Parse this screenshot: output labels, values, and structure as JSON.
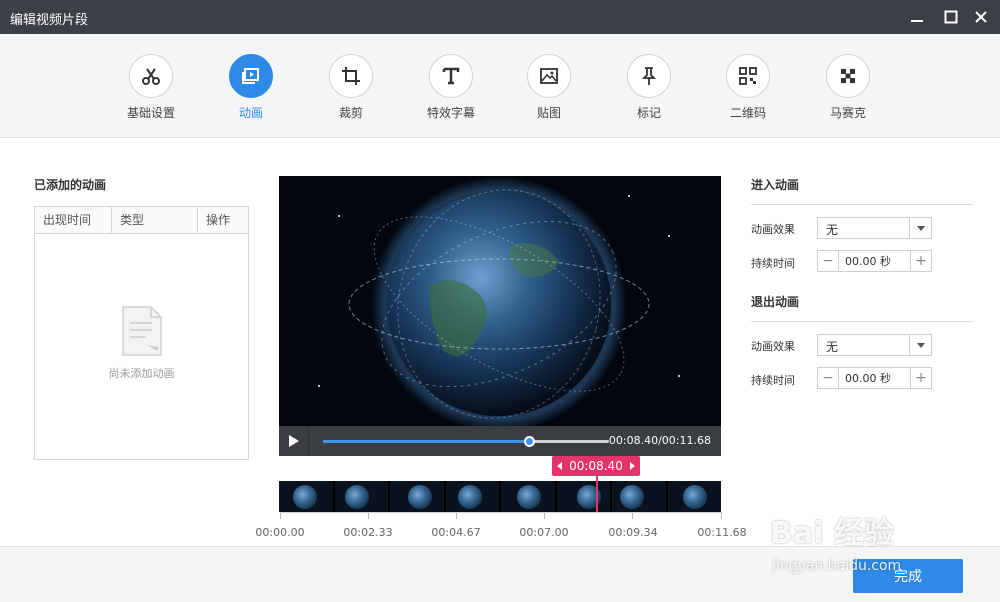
{
  "window": {
    "title": "编辑视频片段"
  },
  "toolbar": {
    "items": [
      {
        "label": "基础设置",
        "icon": "scissors-icon"
      },
      {
        "label": "动画",
        "icon": "animation-play-icon",
        "active": true
      },
      {
        "label": "裁剪",
        "icon": "crop-icon"
      },
      {
        "label": "特效字幕",
        "icon": "text-icon"
      },
      {
        "label": "贴图",
        "icon": "image-icon"
      },
      {
        "label": "标记",
        "icon": "pin-icon"
      },
      {
        "label": "二维码",
        "icon": "qrcode-icon"
      },
      {
        "label": "马赛克",
        "icon": "mosaic-icon"
      }
    ]
  },
  "added_animations": {
    "title": "已添加的动画",
    "columns": [
      "出现时间",
      "类型",
      "操作"
    ],
    "empty_text": "尚未添加动画"
  },
  "player": {
    "time_readout": "00:08.40/00:11.68",
    "progress": 0.72
  },
  "timeline": {
    "playhead_time": "00:08.40",
    "ticks": [
      "00:00.00",
      "00:02.33",
      "00:04.67",
      "00:07.00",
      "00:09.34",
      "00:11.68"
    ]
  },
  "enter_animation": {
    "title": "进入动画",
    "effect_label": "动画效果",
    "effect_value": "无",
    "duration_label": "持续时间",
    "duration_value": "00.00 秒"
  },
  "exit_animation": {
    "title": "退出动画",
    "effect_label": "动画效果",
    "effect_value": "无",
    "duration_label": "持续时间",
    "duration_value": "00.00 秒"
  },
  "footer": {
    "done_label": "完成"
  },
  "watermark": {
    "brand": "Bai 经验",
    "url": "jingyan.baidu.com"
  },
  "colors": {
    "accent": "#2e8ae6",
    "playhead": "#e3336b",
    "titlebar": "#3c3f45"
  }
}
